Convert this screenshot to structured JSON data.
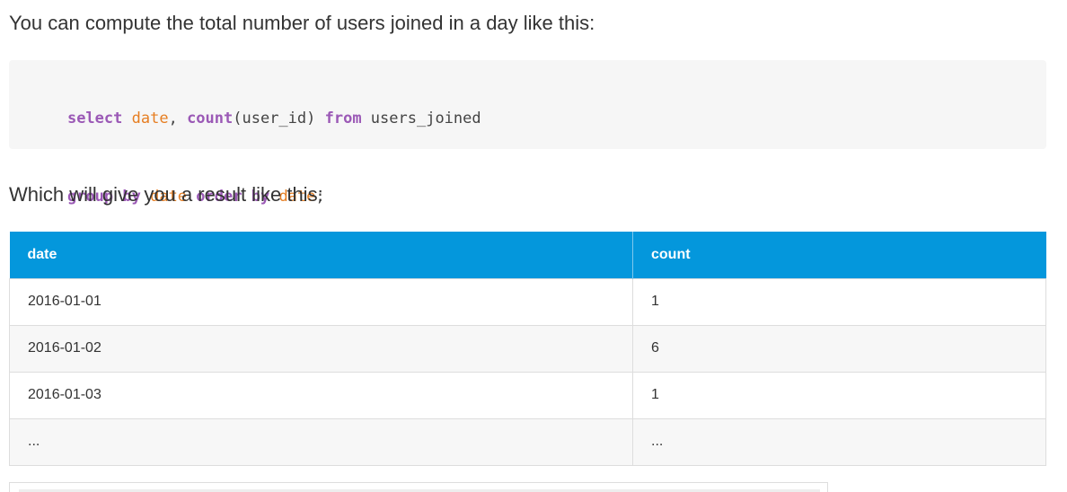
{
  "paragraphs": {
    "intro": "You can compute the total number of users joined in a day like this:",
    "result_intro": "Which will give you a result like this:"
  },
  "code": {
    "line1": [
      {
        "text": "select",
        "kind": "kw"
      },
      {
        "text": " ",
        "kind": "plain"
      },
      {
        "text": "date",
        "kind": "id"
      },
      {
        "text": ", ",
        "kind": "plain"
      },
      {
        "text": "count",
        "kind": "kw"
      },
      {
        "text": "(user_id) ",
        "kind": "plain"
      },
      {
        "text": "from",
        "kind": "kw"
      },
      {
        "text": " users_joined",
        "kind": "plain"
      }
    ],
    "line2": [
      {
        "text": "group by",
        "kind": "kw"
      },
      {
        "text": " ",
        "kind": "plain"
      },
      {
        "text": "date",
        "kind": "id"
      },
      {
        "text": " ",
        "kind": "plain"
      },
      {
        "text": "order by",
        "kind": "kw"
      },
      {
        "text": " ",
        "kind": "plain"
      },
      {
        "text": "date",
        "kind": "id"
      },
      {
        "text": ";",
        "kind": "plain"
      }
    ]
  },
  "table": {
    "headers": [
      "date",
      "count"
    ],
    "rows": [
      [
        "2016-01-01",
        "1"
      ],
      [
        "2016-01-02",
        "6"
      ],
      [
        "2016-01-03",
        "1"
      ],
      [
        "...",
        "..."
      ]
    ]
  },
  "colors": {
    "keyword": "#9b59b6",
    "identifier": "#e67e22",
    "table_header_bg": "#0497dc"
  }
}
